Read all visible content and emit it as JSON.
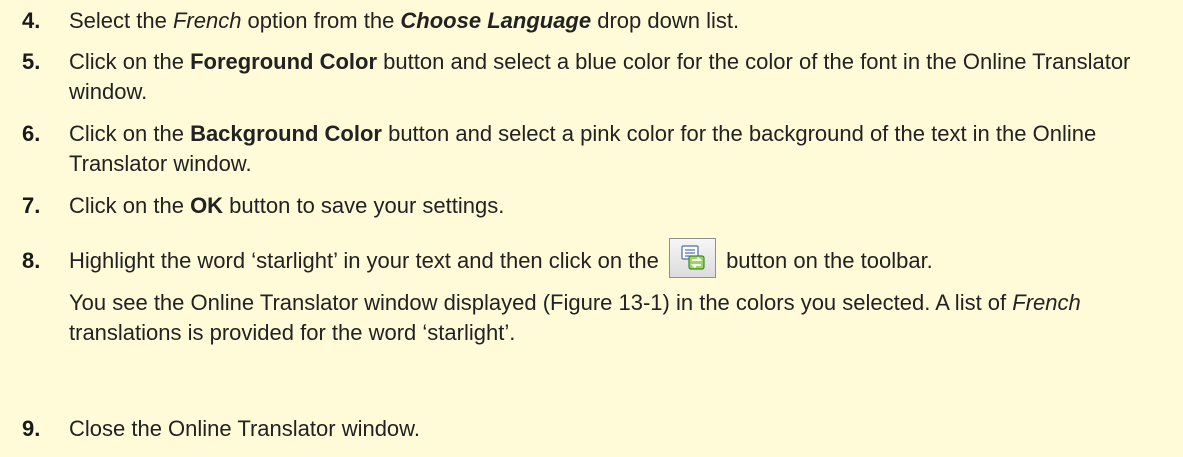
{
  "steps": [
    {
      "number": "4.",
      "parts": [
        "Select the ",
        "French",
        " option from the ",
        "Choose Language",
        " drop down list."
      ]
    },
    {
      "number": "5.",
      "parts": [
        "Click on the ",
        "Foreground Color",
        " button and select a blue color for the color of the font in the Online Translator window."
      ]
    },
    {
      "number": "6.",
      "parts": [
        "Click on the ",
        "Background Color",
        " button and select a pink color for the background of the text in the Online Translator window."
      ]
    },
    {
      "number": "7.",
      "parts": [
        "Click on the ",
        "OK",
        " button to save your settings."
      ]
    },
    {
      "number": "8.",
      "parts": [
        "Highlight the word ‘starlight’ in your text and then click on the ",
        " button on the toolbar."
      ],
      "toolbar_icon": "translate-icon",
      "note_parts": [
        "You see the Online Translator window displayed (Figure 13-1) in the colors you selected. A list of ",
        "French",
        " translations is provided for the word ‘starlight’."
      ]
    },
    {
      "number": "9.",
      "parts": [
        "Close the Online Translator window."
      ]
    }
  ]
}
